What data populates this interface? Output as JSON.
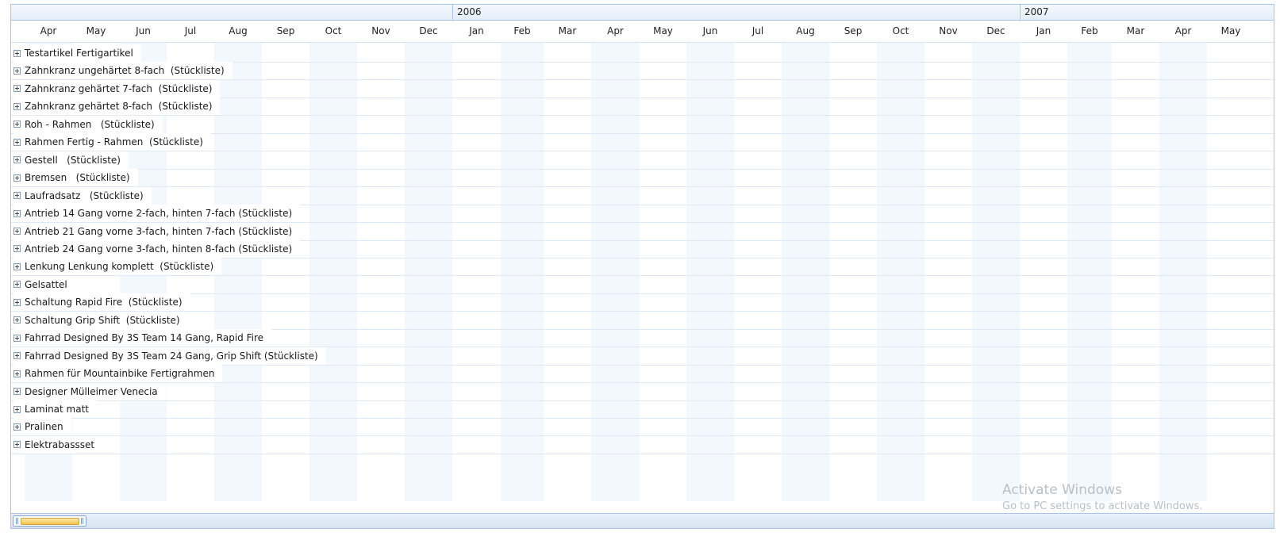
{
  "timeline": {
    "years": [
      {
        "label": "2006",
        "start_month_index": 9
      },
      {
        "label": "2007",
        "start_month_index": 21
      }
    ],
    "months": [
      "Apr",
      "May",
      "Jun",
      "Jul",
      "Aug",
      "Sep",
      "Oct",
      "Nov",
      "Dec",
      "Jan",
      "Feb",
      "Mar",
      "Apr",
      "May",
      "Jun",
      "Jul",
      "Aug",
      "Sep",
      "Oct",
      "Nov",
      "Dec",
      "Jan",
      "Feb",
      "Mar",
      "Apr",
      "May"
    ]
  },
  "rows": [
    {
      "label": "Testartikel Fertigartikel"
    },
    {
      "label": "Zahnkranz ungehärtet 8-fach  (Stückliste)"
    },
    {
      "label": "Zahnkranz gehärtet 7-fach  (Stückliste)"
    },
    {
      "label": "Zahnkranz gehärtet 8-fach  (Stückliste)"
    },
    {
      "label": "Roh - Rahmen   (Stückliste)"
    },
    {
      "label": "Rahmen Fertig - Rahmen  (Stückliste)"
    },
    {
      "label": "Gestell   (Stückliste)"
    },
    {
      "label": "Bremsen   (Stückliste)"
    },
    {
      "label": "Laufradsatz   (Stückliste)"
    },
    {
      "label": "Antrieb 14 Gang vorne 2-fach, hinten 7-fach (Stückliste)"
    },
    {
      "label": "Antrieb 21 Gang vorne 3-fach, hinten 7-fach (Stückliste)"
    },
    {
      "label": "Antrieb 24 Gang vorne 3-fach, hinten 8-fach (Stückliste)"
    },
    {
      "label": "Lenkung Lenkung komplett  (Stückliste)"
    },
    {
      "label": "Gelsattel"
    },
    {
      "label": "Schaltung Rapid Fire  (Stückliste)"
    },
    {
      "label": "Schaltung Grip Shift  (Stückliste)"
    },
    {
      "label": "Fahrrad Designed By 3S Team 14 Gang, Rapid Fire"
    },
    {
      "label": "Fahrrad Designed By 3S Team 24 Gang, Grip Shift (Stückliste)"
    },
    {
      "label": "Rahmen für Mountainbike Fertigrahmen"
    },
    {
      "label": "Designer Mülleimer Venecia"
    },
    {
      "label": "Laminat matt"
    },
    {
      "label": "Pralinen"
    },
    {
      "label": "Elektrabassset"
    }
  ],
  "watermark": {
    "title": "Activate Windows",
    "subtitle": "Go to PC settings to activate Windows."
  },
  "icons": {
    "expander": "plus-box-icon"
  },
  "colors": {
    "band": "#f3f8fe",
    "border": "#a9c4e4",
    "scroll_fill": "#f5c34b"
  }
}
